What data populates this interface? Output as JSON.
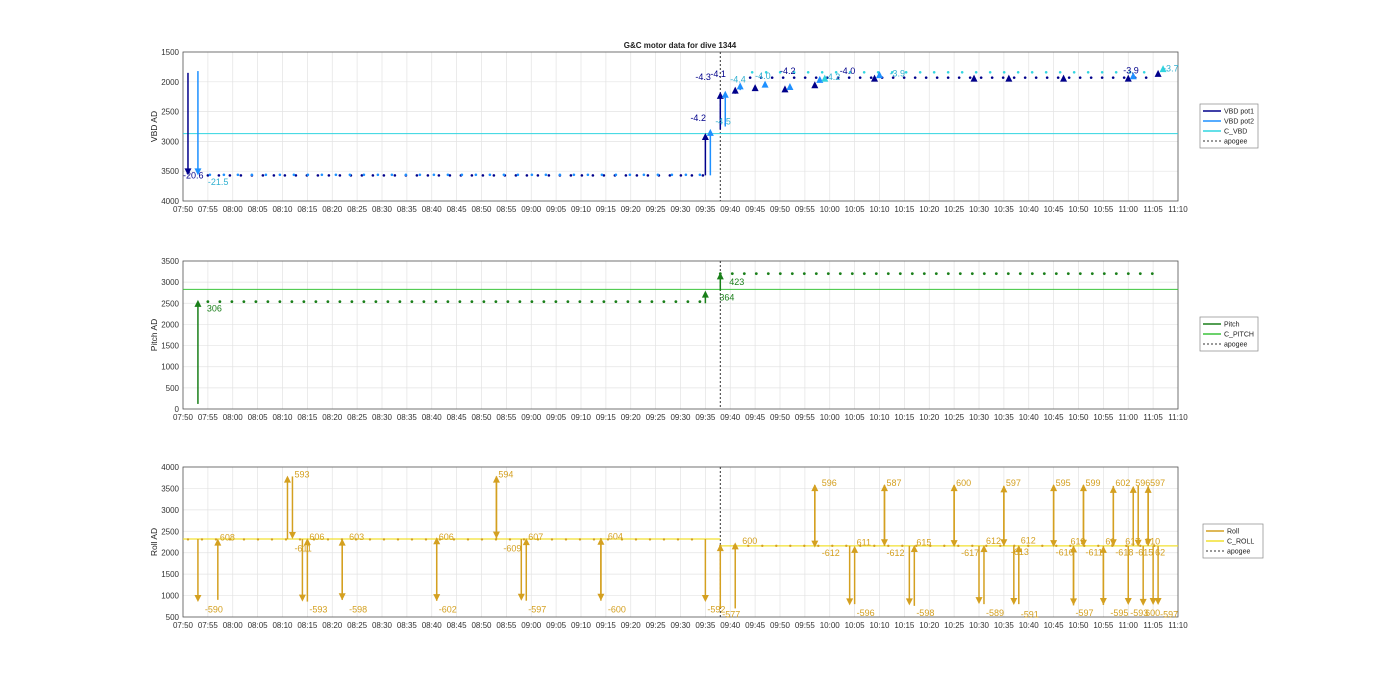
{
  "chart_data": {
    "type": "line",
    "title": "G&C motor data for dive 1344",
    "x_ticks": [
      "07:50",
      "07:55",
      "08:00",
      "08:05",
      "08:10",
      "08:15",
      "08:20",
      "08:25",
      "08:30",
      "08:35",
      "08:40",
      "08:45",
      "08:50",
      "08:55",
      "09:00",
      "09:05",
      "09:10",
      "09:15",
      "09:20",
      "09:25",
      "09:30",
      "09:35",
      "09:40",
      "09:45",
      "09:50",
      "09:55",
      "10:00",
      "10:05",
      "10:10",
      "10:15",
      "10:20",
      "10:25",
      "10:30",
      "10:35",
      "10:40",
      "10:45",
      "10:50",
      "10:55",
      "11:00",
      "11:05",
      "11:10"
    ],
    "xlim": [
      "07:50",
      "11:10"
    ],
    "grid": true,
    "apogee": "09:38",
    "panels": [
      {
        "ylabel": "VBD AD",
        "ylim": [
          1500,
          4000
        ],
        "y_reversed": true,
        "y_ticks": [
          1500,
          2000,
          2500,
          3000,
          3500,
          4000
        ],
        "legend": [
          "VBD pot1",
          "VBD pot2",
          "C_VBD",
          "apogee"
        ],
        "legend_colors": [
          "#00008B",
          "#1E90FF",
          "#30D5E0",
          "#333333"
        ],
        "reference_line": {
          "name": "C_VBD",
          "y": 2870
        },
        "baseline": {
          "start": "07:55",
          "end": "09:35",
          "pot1": 3570,
          "pot2": 3560
        },
        "baseline2": {
          "start": "09:44",
          "end": "11:04",
          "pot1": 1930,
          "pot2": 1840
        },
        "arrows": [
          {
            "x": "07:51",
            "y0": 1850,
            "y1": 3570,
            "color": "#00008B"
          },
          {
            "x": "07:53",
            "y0": 1820,
            "y1": 3570,
            "color": "#1E90FF"
          },
          {
            "x": "09:35",
            "y0": 3570,
            "y1": 2860,
            "color": "#00008B"
          },
          {
            "x": "09:36",
            "y0": 3570,
            "y1": 2790,
            "color": "#1E90FF"
          },
          {
            "x": "09:38",
            "y0": 2800,
            "y1": 2170,
            "color": "#00008B"
          },
          {
            "x": "09:39",
            "y0": 2750,
            "y1": 2150,
            "color": "#1E90FF"
          },
          {
            "x": "09:41",
            "y0": 2200,
            "y1": 2080,
            "color": "#00008B"
          },
          {
            "x": "09:42",
            "y0": 2140,
            "y1": 2010,
            "color": "#1E90FF"
          },
          {
            "x": "09:45",
            "y0": 2140,
            "y1": 2040,
            "color": "#00008B"
          },
          {
            "x": "09:47",
            "y0": 2080,
            "y1": 1980,
            "color": "#1E90FF"
          },
          {
            "x": "09:51",
            "y0": 2130,
            "y1": 2060,
            "color": "#00008B"
          },
          {
            "x": "09:52",
            "y0": 2110,
            "y1": 2020,
            "color": "#1E90FF"
          },
          {
            "x": "09:57",
            "y0": 2060,
            "y1": 1990,
            "color": "#00008B"
          },
          {
            "x": "09:58",
            "y0": 2000,
            "y1": 1900,
            "color": "#1E90FF"
          },
          {
            "x": "09:59",
            "y0": 1960,
            "y1": 1880,
            "color": "#30D5E0"
          },
          {
            "x": "10:09",
            "y0": 1960,
            "y1": 1880,
            "color": "#00008B"
          },
          {
            "x": "10:10",
            "y0": 1900,
            "y1": 1820,
            "color": "#1E90FF"
          },
          {
            "x": "10:29",
            "y0": 1960,
            "y1": 1880,
            "color": "#00008B"
          },
          {
            "x": "10:36",
            "y0": 1960,
            "y1": 1880,
            "color": "#00008B"
          },
          {
            "x": "10:47",
            "y0": 1960,
            "y1": 1880,
            "color": "#00008B"
          },
          {
            "x": "11:00",
            "y0": 1960,
            "y1": 1880,
            "color": "#00008B"
          },
          {
            "x": "11:01",
            "y0": 1920,
            "y1": 1840,
            "color": "#1E90FF"
          },
          {
            "x": "11:06",
            "y0": 1900,
            "y1": 1800,
            "color": "#00008B"
          },
          {
            "x": "11:07",
            "y0": 1830,
            "y1": 1720,
            "color": "#30D5E0"
          }
        ],
        "labels": [
          {
            "x": "07:50",
            "y": 3570,
            "text": "-20.6",
            "color": "#00008B"
          },
          {
            "x": "07:55",
            "y": 3680,
            "text": "-21.5",
            "color": "#30B0D0"
          },
          {
            "x": "09:32",
            "y": 2610,
            "text": "-4.2",
            "color": "#00008B"
          },
          {
            "x": "09:37",
            "y": 2670,
            "text": "-4.5",
            "color": "#30B0D0"
          },
          {
            "x": "09:33",
            "y": 1920,
            "text": "-4.3",
            "color": "#00008B"
          },
          {
            "x": "09:36",
            "y": 1870,
            "text": "-4.1",
            "color": "#00008B"
          },
          {
            "x": "09:40",
            "y": 1960,
            "text": "-4.4",
            "color": "#30B0D0"
          },
          {
            "x": "09:45",
            "y": 1900,
            "text": "-4.0",
            "color": "#30B0D0"
          },
          {
            "x": "09:50",
            "y": 1820,
            "text": "-4.2",
            "color": "#00008B"
          },
          {
            "x": "09:59",
            "y": 1920,
            "text": "-4.2",
            "color": "#30B0D0"
          },
          {
            "x": "10:02",
            "y": 1820,
            "text": "-4.0",
            "color": "#00008B"
          },
          {
            "x": "10:12",
            "y": 1860,
            "text": "-3.9",
            "color": "#30B0D0"
          },
          {
            "x": "10:59",
            "y": 1810,
            "text": "-3.9",
            "color": "#00008B"
          },
          {
            "x": "11:07",
            "y": 1780,
            "text": "-3.7",
            "color": "#30B0D0"
          }
        ]
      },
      {
        "ylabel": "Pitch AD",
        "ylim": [
          0,
          3500
        ],
        "y_ticks": [
          0,
          500,
          1000,
          1500,
          2000,
          2500,
          3000,
          3500
        ],
        "legend": [
          "Pitch",
          "C_PITCH",
          "apogee"
        ],
        "legend_colors": [
          "#1A7F1A",
          "#3CC43C",
          "#333333"
        ],
        "reference_line": {
          "name": "C_PITCH",
          "y": 2830
        },
        "segments": [
          {
            "start": "07:55",
            "end": "09:34",
            "y": 2540
          },
          {
            "start": "09:38",
            "end": "11:07",
            "y": 3200
          }
        ],
        "arrows": [
          {
            "x": "07:53",
            "y0": 120,
            "y1": 2580
          },
          {
            "x": "09:35",
            "y0": 2500,
            "y1": 2800
          },
          {
            "x": "09:38",
            "y0": 2800,
            "y1": 3230
          }
        ],
        "labels": [
          {
            "x": "07:54",
            "y": 2300,
            "text": "306"
          },
          {
            "x": "09:37",
            "y": 2560,
            "text": "364"
          },
          {
            "x": "09:39",
            "y": 2930,
            "text": "423"
          }
        ]
      },
      {
        "ylabel": "Roll AD",
        "ylim": [
          500,
          4000
        ],
        "y_ticks": [
          500,
          1000,
          1500,
          2000,
          2500,
          3000,
          3500,
          4000
        ],
        "legend": [
          "Roll",
          "C_ROLL",
          "apogee"
        ],
        "legend_colors": [
          "#D4A020",
          "#F2E030",
          "#333333"
        ],
        "c_roll": [
          {
            "start": "07:50",
            "end": "09:38",
            "y": 2320
          },
          {
            "start": "09:38",
            "end": "11:10",
            "y": 2160
          }
        ],
        "base": [
          {
            "start": "07:51",
            "end": "09:35",
            "y": 2310
          },
          {
            "start": "09:38",
            "end": "11:08",
            "y": 2160
          }
        ],
        "arrows": [
          {
            "x": "07:53",
            "y0": 2320,
            "y1": 850
          },
          {
            "x": "07:57",
            "y0": 900,
            "y1": 2330
          },
          {
            "x": "08:11",
            "y0": 2320,
            "y1": 3800
          },
          {
            "x": "08:12",
            "y0": 3780,
            "y1": 2320
          },
          {
            "x": "08:14",
            "y0": 2320,
            "y1": 860
          },
          {
            "x": "08:15",
            "y0": 860,
            "y1": 2340
          },
          {
            "x": "08:22",
            "y0": 900,
            "y1": 2330
          },
          {
            "x": "08:22",
            "y0": 2330,
            "y1": 890
          },
          {
            "x": "08:41",
            "y0": 880,
            "y1": 2360
          },
          {
            "x": "08:41",
            "y0": 2340,
            "y1": 870
          },
          {
            "x": "08:53",
            "y0": 2320,
            "y1": 3800
          },
          {
            "x": "08:53",
            "y0": 3780,
            "y1": 2330
          },
          {
            "x": "08:58",
            "y0": 2320,
            "y1": 880
          },
          {
            "x": "08:59",
            "y0": 880,
            "y1": 2340
          },
          {
            "x": "09:14",
            "y0": 2340,
            "y1": 880
          },
          {
            "x": "09:14",
            "y0": 880,
            "y1": 2350
          },
          {
            "x": "09:35",
            "y0": 2320,
            "y1": 850
          },
          {
            "x": "09:38",
            "y0": 700,
            "y1": 2200
          },
          {
            "x": "09:41",
            "y0": 700,
            "y1": 2240
          },
          {
            "x": "09:57",
            "y0": 2160,
            "y1": 3600
          },
          {
            "x": "09:57",
            "y0": 3580,
            "y1": 2120
          },
          {
            "x": "10:04",
            "y0": 2160,
            "y1": 770
          },
          {
            "x": "10:05",
            "y0": 800,
            "y1": 2160
          },
          {
            "x": "10:11",
            "y0": 2160,
            "y1": 3600
          },
          {
            "x": "10:11",
            "y0": 3580,
            "y1": 2150
          },
          {
            "x": "10:16",
            "y0": 2160,
            "y1": 770
          },
          {
            "x": "10:17",
            "y0": 760,
            "y1": 2180
          },
          {
            "x": "10:25",
            "y0": 2160,
            "y1": 3600
          },
          {
            "x": "10:25",
            "y0": 3580,
            "y1": 2130
          },
          {
            "x": "10:30",
            "y0": 2160,
            "y1": 800
          },
          {
            "x": "10:31",
            "y0": 800,
            "y1": 2180
          },
          {
            "x": "10:35",
            "y0": 2160,
            "y1": 3570
          },
          {
            "x": "10:35",
            "y0": 3560,
            "y1": 2150
          },
          {
            "x": "10:37",
            "y0": 2160,
            "y1": 780
          },
          {
            "x": "10:38",
            "y0": 800,
            "y1": 2180
          },
          {
            "x": "10:45",
            "y0": 2160,
            "y1": 3600
          },
          {
            "x": "10:45",
            "y0": 3580,
            "y1": 2130
          },
          {
            "x": "10:49",
            "y0": 2160,
            "y1": 770
          },
          {
            "x": "10:49",
            "y0": 770,
            "y1": 2170
          },
          {
            "x": "10:51",
            "y0": 2160,
            "y1": 3600
          },
          {
            "x": "10:51",
            "y0": 3580,
            "y1": 2140
          },
          {
            "x": "10:55",
            "y0": 2160,
            "y1": 780
          },
          {
            "x": "10:55",
            "y0": 780,
            "y1": 2160
          },
          {
            "x": "10:57",
            "y0": 2160,
            "y1": 3560
          },
          {
            "x": "10:57",
            "y0": 3560,
            "y1": 2150
          },
          {
            "x": "11:00",
            "y0": 2160,
            "y1": 780
          },
          {
            "x": "11:01",
            "y0": 2160,
            "y1": 3560
          },
          {
            "x": "11:02",
            "y0": 3560,
            "y1": 2140
          },
          {
            "x": "11:03",
            "y0": 2160,
            "y1": 760
          },
          {
            "x": "11:04",
            "y0": 2160,
            "y1": 3560
          },
          {
            "x": "11:04",
            "y0": 3550,
            "y1": 2160
          },
          {
            "x": "11:05",
            "y0": 2160,
            "y1": 780
          },
          {
            "x": "11:06",
            "y0": 2160,
            "y1": 780
          }
        ],
        "labels": [
          {
            "x": "07:54",
            "y": 680,
            "text": "-590"
          },
          {
            "x": "07:57",
            "y": 2360,
            "text": "608"
          },
          {
            "x": "08:12",
            "y": 3830,
            "text": "593"
          },
          {
            "x": "08:12",
            "y": 2100,
            "text": "-611"
          },
          {
            "x": "08:15",
            "y": 2370,
            "text": "606"
          },
          {
            "x": "08:15",
            "y": 680,
            "text": "-593"
          },
          {
            "x": "08:23",
            "y": 2370,
            "text": "603"
          },
          {
            "x": "08:23",
            "y": 680,
            "text": "-598"
          },
          {
            "x": "08:41",
            "y": 2370,
            "text": "606"
          },
          {
            "x": "08:41",
            "y": 680,
            "text": "-602"
          },
          {
            "x": "08:53",
            "y": 3830,
            "text": "594"
          },
          {
            "x": "08:54",
            "y": 2100,
            "text": "-609"
          },
          {
            "x": "08:59",
            "y": 2370,
            "text": "607"
          },
          {
            "x": "08:59",
            "y": 680,
            "text": "-597"
          },
          {
            "x": "09:15",
            "y": 2380,
            "text": "604"
          },
          {
            "x": "09:15",
            "y": 680,
            "text": "-600"
          },
          {
            "x": "09:35",
            "y": 680,
            "text": "-592"
          },
          {
            "x": "09:38",
            "y": 560,
            "text": "-577"
          },
          {
            "x": "09:42",
            "y": 2270,
            "text": "600"
          },
          {
            "x": "09:58",
            "y": 3630,
            "text": "596"
          },
          {
            "x": "09:58",
            "y": 1990,
            "text": "-612"
          },
          {
            "x": "10:05",
            "y": 2240,
            "text": "611"
          },
          {
            "x": "10:05",
            "y": 590,
            "text": "-596"
          },
          {
            "x": "10:11",
            "y": 3630,
            "text": "587"
          },
          {
            "x": "10:11",
            "y": 1990,
            "text": "-612"
          },
          {
            "x": "10:17",
            "y": 2240,
            "text": "615"
          },
          {
            "x": "10:17",
            "y": 590,
            "text": "-598"
          },
          {
            "x": "10:25",
            "y": 3630,
            "text": "600"
          },
          {
            "x": "10:26",
            "y": 1990,
            "text": "-617"
          },
          {
            "x": "10:31",
            "y": 2270,
            "text": "612"
          },
          {
            "x": "10:31",
            "y": 590,
            "text": "-589"
          },
          {
            "x": "10:35",
            "y": 3630,
            "text": "597"
          },
          {
            "x": "10:36",
            "y": 2020,
            "text": "-613"
          },
          {
            "x": "10:38",
            "y": 2280,
            "text": "612"
          },
          {
            "x": "10:38",
            "y": 560,
            "text": "-591"
          },
          {
            "x": "10:45",
            "y": 3630,
            "text": "595"
          },
          {
            "x": "10:45",
            "y": 2000,
            "text": "-616"
          },
          {
            "x": "10:48",
            "y": 2260,
            "text": "613"
          },
          {
            "x": "10:49",
            "y": 590,
            "text": "-597"
          },
          {
            "x": "10:51",
            "y": 3630,
            "text": "599"
          },
          {
            "x": "10:51",
            "y": 2010,
            "text": "-611"
          },
          {
            "x": "10:55",
            "y": 2260,
            "text": "61"
          },
          {
            "x": "10:56",
            "y": 590,
            "text": "-595"
          },
          {
            "x": "10:57",
            "y": 3630,
            "text": "602"
          },
          {
            "x": "10:57",
            "y": 2000,
            "text": "-618"
          },
          {
            "x": "10:59",
            "y": 2260,
            "text": "617"
          },
          {
            "x": "11:00",
            "y": 590,
            "text": "-593"
          },
          {
            "x": "11:01",
            "y": 3630,
            "text": "596"
          },
          {
            "x": "11:01",
            "y": 2000,
            "text": "-615"
          },
          {
            "x": "11:03",
            "y": 2260,
            "text": "610"
          },
          {
            "x": "11:03",
            "y": 590,
            "text": "600"
          },
          {
            "x": "11:04",
            "y": 3630,
            "text": "597"
          },
          {
            "x": "11:05",
            "y": 2000,
            "text": "62"
          },
          {
            "x": "11:06",
            "y": 560,
            "text": "-597"
          }
        ]
      }
    ]
  }
}
